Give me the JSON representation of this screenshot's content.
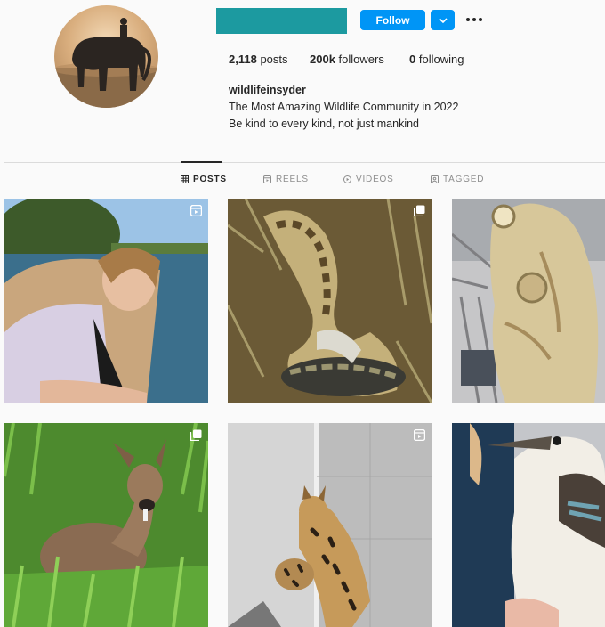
{
  "profile": {
    "follow_label": "Follow",
    "stats": {
      "posts_count": "2,118",
      "posts_label": "posts",
      "followers_count": "200k",
      "followers_label": "followers",
      "following_count": "0",
      "following_label": "following"
    },
    "bio": {
      "name": "wildlifeinsyder",
      "lines": [
        "The Most Amazing Wildlife Community in 2022",
        "Be kind to every kind, not just mankind"
      ]
    },
    "username_redaction_color": "#1c9aa0",
    "accent_color": "#0095f6"
  },
  "tabs": [
    {
      "label": "POSTS",
      "icon": "grid-icon",
      "active": true
    },
    {
      "label": "REELS",
      "icon": "reels-icon",
      "active": false
    },
    {
      "label": "VIDEOS",
      "icon": "video-icon",
      "active": false
    },
    {
      "label": "TAGGED",
      "icon": "tagged-icon",
      "active": false
    }
  ],
  "posts": [
    {
      "subject": "woman by lake",
      "badge": "reel-icon"
    },
    {
      "subject": "python snake in grass",
      "badge": "carousel-icon"
    },
    {
      "subject": "whale heart specimen",
      "badge": null
    },
    {
      "subject": "young deer in grass",
      "badge": "carousel-icon"
    },
    {
      "subject": "serval cat and kitten",
      "badge": "reel-icon"
    },
    {
      "subject": "kookaburra bird held by hand",
      "badge": null
    }
  ]
}
